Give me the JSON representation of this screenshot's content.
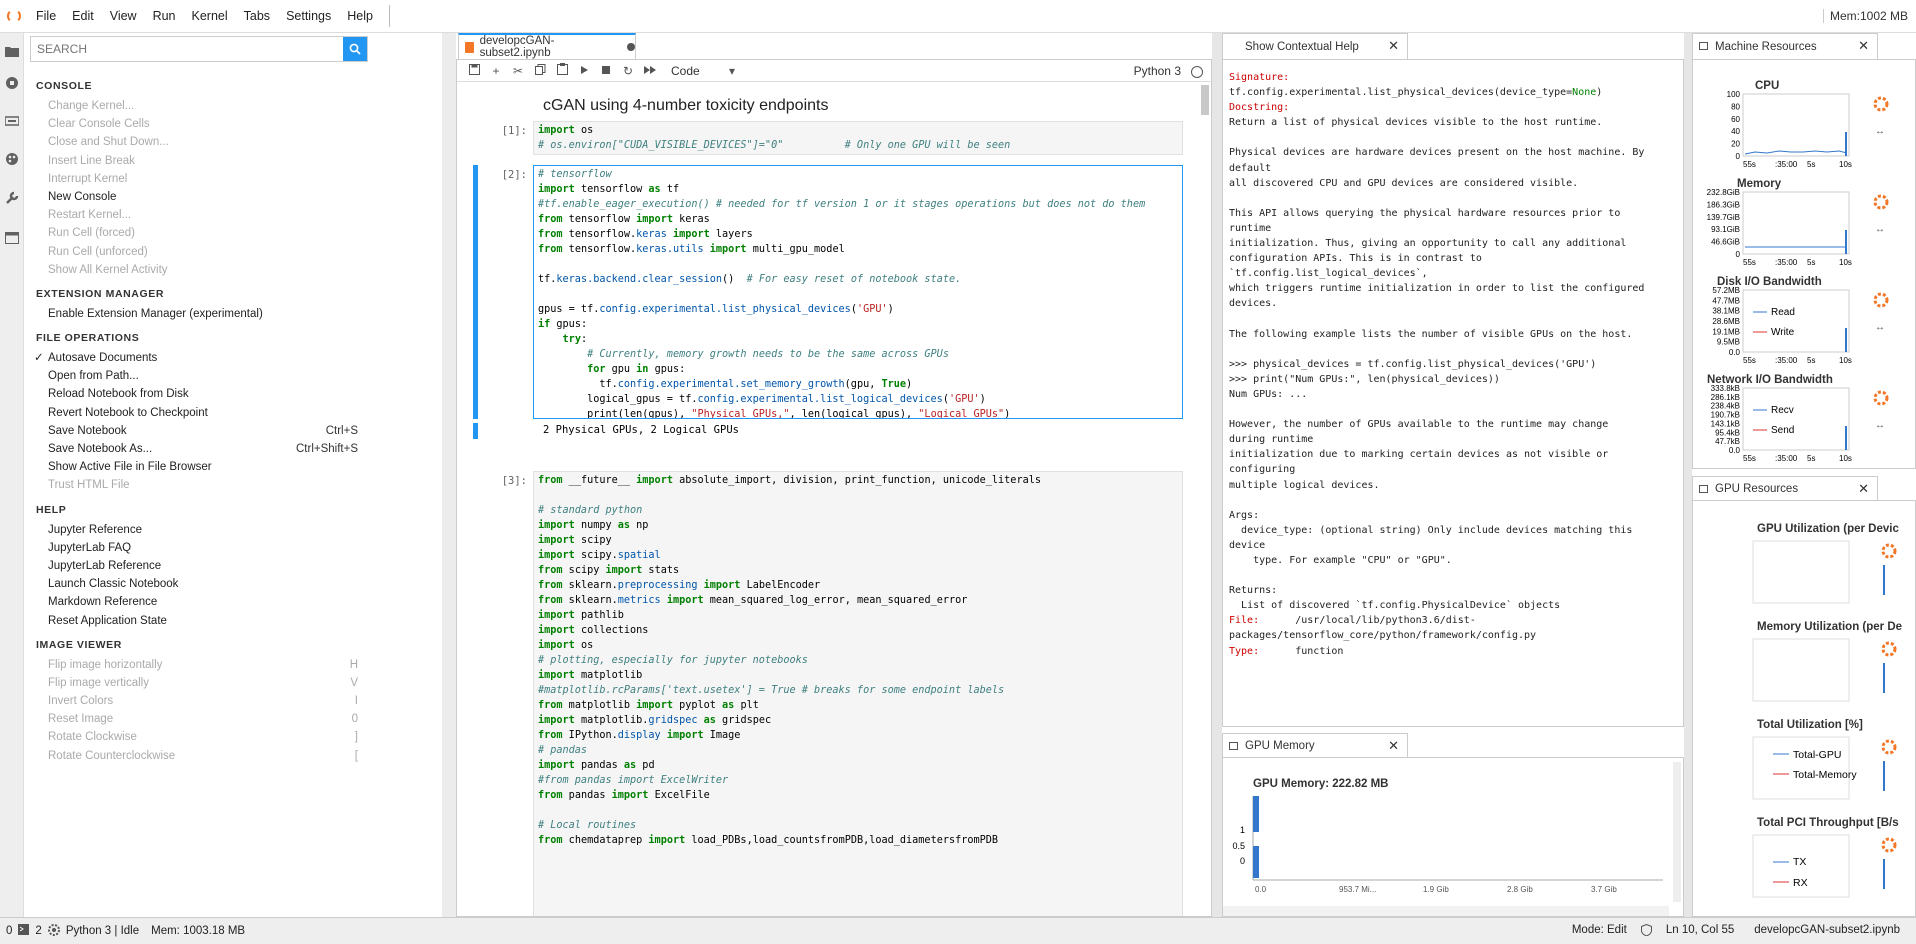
{
  "menubar": {
    "items": [
      "File",
      "Edit",
      "View",
      "Run",
      "Kernel",
      "Tabs",
      "Settings",
      "Help"
    ],
    "memory": "Mem:1002 MB"
  },
  "left_panel": {
    "search_placeholder": "SEARCH",
    "sections": [
      {
        "title": "CONSOLE",
        "items": [
          {
            "label": "Change Kernel...",
            "disabled": true,
            "shortcut": ""
          },
          {
            "label": "Clear Console Cells",
            "disabled": true,
            "shortcut": ""
          },
          {
            "label": "Close and Shut Down...",
            "disabled": true,
            "shortcut": ""
          },
          {
            "label": "Insert Line Break",
            "disabled": true,
            "shortcut": ""
          },
          {
            "label": "Interrupt Kernel",
            "disabled": true,
            "shortcut": ""
          },
          {
            "label": "New Console",
            "disabled": false,
            "shortcut": ""
          },
          {
            "label": "Restart Kernel...",
            "disabled": true,
            "shortcut": ""
          },
          {
            "label": "Run Cell (forced)",
            "disabled": true,
            "shortcut": ""
          },
          {
            "label": "Run Cell (unforced)",
            "disabled": true,
            "shortcut": ""
          },
          {
            "label": "Show All Kernel Activity",
            "disabled": true,
            "shortcut": ""
          }
        ]
      },
      {
        "title": "EXTENSION MANAGER",
        "items": [
          {
            "label": "Enable Extension Manager (experimental)",
            "disabled": false,
            "shortcut": ""
          }
        ]
      },
      {
        "title": "FILE OPERATIONS",
        "items": [
          {
            "label": "Autosave Documents",
            "disabled": false,
            "shortcut": "",
            "checked": true
          },
          {
            "label": "Open from Path...",
            "disabled": false,
            "shortcut": ""
          },
          {
            "label": "Reload Notebook from Disk",
            "disabled": false,
            "shortcut": ""
          },
          {
            "label": "Revert Notebook to Checkpoint",
            "disabled": false,
            "shortcut": ""
          },
          {
            "label": "Save Notebook",
            "disabled": false,
            "shortcut": "Ctrl+S"
          },
          {
            "label": "Save Notebook As...",
            "disabled": false,
            "shortcut": "Ctrl+Shift+S"
          },
          {
            "label": "Show Active File in File Browser",
            "disabled": false,
            "shortcut": ""
          },
          {
            "label": "Trust HTML File",
            "disabled": true,
            "shortcut": ""
          }
        ]
      },
      {
        "title": "HELP",
        "items": [
          {
            "label": "Jupyter Reference",
            "disabled": false,
            "shortcut": ""
          },
          {
            "label": "JupyterLab FAQ",
            "disabled": false,
            "shortcut": ""
          },
          {
            "label": "JupyterLab Reference",
            "disabled": false,
            "shortcut": ""
          },
          {
            "label": "Launch Classic Notebook",
            "disabled": false,
            "shortcut": ""
          },
          {
            "label": "Markdown Reference",
            "disabled": false,
            "shortcut": ""
          },
          {
            "label": "Reset Application State",
            "disabled": false,
            "shortcut": ""
          }
        ]
      },
      {
        "title": "IMAGE VIEWER",
        "items": [
          {
            "label": "Flip image horizontally",
            "disabled": true,
            "shortcut": "H"
          },
          {
            "label": "Flip image vertically",
            "disabled": true,
            "shortcut": "V"
          },
          {
            "label": "Invert Colors",
            "disabled": true,
            "shortcut": "I"
          },
          {
            "label": "Reset Image",
            "disabled": true,
            "shortcut": "0"
          },
          {
            "label": "Rotate Clockwise",
            "disabled": true,
            "shortcut": "]"
          },
          {
            "label": "Rotate Counterclockwise",
            "disabled": true,
            "shortcut": "["
          }
        ]
      }
    ]
  },
  "notebook": {
    "tab_title": "developcGAN-subset2.ipynb",
    "cell_type": "Code",
    "kernel": "Python 3",
    "markdown_title": "cGAN using 4-number toxicity endpoints",
    "prompt1": "[1]:",
    "prompt2": "[2]:",
    "prompt3": "[3]:",
    "output2": "2 Physical GPUs, 2 Logical GPUs"
  },
  "help_panel": {
    "title": "Show Contextual Help",
    "signature_label": "Signature:",
    "signature": "tf.config.experimental.list_physical_devices(device_type=None)",
    "signature_fn": "tf.config.experimental.list_physical_devices(device_type=",
    "signature_default": "None",
    "signature_end": ")",
    "docstring_label": "Docstring:",
    "body": "Return a list of physical devices visible to the host runtime.\n\nPhysical devices are hardware devices present on the host machine. By\ndefault\nall discovered CPU and GPU devices are considered visible.\n\nThis API allows querying the physical hardware resources prior to\nruntime\ninitialization. Thus, giving an opportunity to call any additional\nconfiguration APIs. This is in contrast to\n`tf.config.list_logical_devices`,\nwhich triggers runtime initialization in order to list the configured\ndevices.\n\nThe following example lists the number of visible GPUs on the host.\n\n>>> physical_devices = tf.config.list_physical_devices('GPU')\n>>> print(\"Num GPUs:\", len(physical_devices))\nNum GPUs: ...\n\nHowever, the number of GPUs available to the runtime may change\nduring runtime\ninitialization due to marking certain devices as not visible or\nconfiguring\nmultiple logical devices.\n\nArgs:\n  device_type: (optional string) Only include devices matching this\ndevice\n    type. For example \"CPU\" or \"GPU\".\n\nReturns:\n  List of discovered `tf.config.PhysicalDevice` objects",
    "file_label": "File:",
    "file": "      /usr/local/lib/python3.6/dist-\npackages/tensorflow_core/python/framework/config.py",
    "type_label": "Type:",
    "type": "      function"
  },
  "gpu_memory": {
    "tab": "GPU Memory",
    "title": "GPU Memory: 222.82 MB",
    "yticks": [
      "1",
      "0.5",
      "0"
    ],
    "xticks": [
      "0.0",
      "953.7 Mi...",
      "1.9 Gib",
      "2.8 Gib",
      "3.7 Gib"
    ]
  },
  "machine_resources": {
    "tab": "Machine Resources",
    "cpu": {
      "title": "CPU",
      "yticks": [
        "100",
        "80",
        "60",
        "40",
        "20",
        "0"
      ],
      "xticks": [
        "55s",
        ":35:00",
        "5s",
        "10s"
      ]
    },
    "memory": {
      "title": "Memory",
      "yticks": [
        "232.8GiB",
        "186.3GiB",
        "139.7GiB",
        "93.1GiB",
        "46.6GiB",
        "0"
      ],
      "xticks": [
        "55s",
        ":35:00",
        "5s",
        "10s"
      ]
    },
    "disk": {
      "title": "Disk I/O Bandwidth",
      "yticks": [
        "57.2MB",
        "47.7MB",
        "38.1MB",
        "28.6MB",
        "19.1MB",
        "9.5MB",
        "0.0"
      ],
      "legend": [
        "Read",
        "Write"
      ],
      "xticks": [
        "55s",
        ":35:00",
        "5s",
        "10s"
      ]
    },
    "network": {
      "title": "Network I/O Bandwidth",
      "yticks": [
        "333.8kB",
        "286.1kB",
        "238.4kB",
        "190.7kB",
        "143.1kB",
        "95.4kB",
        "47.7kB",
        "0.0"
      ],
      "legend": [
        "Recv",
        "Send"
      ],
      "xticks": [
        "55s",
        ":35:00",
        "5s",
        "10s"
      ]
    }
  },
  "gpu_resources": {
    "tab": "GPU Resources",
    "titles": [
      "GPU Utilization (per Devic",
      "Memory Utilization (per De",
      "Total Utilization [%]",
      "Total PCI Throughput [B/s"
    ],
    "util_legend": [
      "Total-GPU",
      "Total-Memory"
    ],
    "pci_legend": [
      "TX",
      "RX"
    ]
  },
  "statusbar": {
    "left_num1": "0",
    "left_num2": "2",
    "kernel_status": "Python 3 | Idle",
    "mem": "Mem: 1003.18 MB",
    "mode": "Mode: Edit",
    "position": "Ln 10, Col 55",
    "file": "developcGAN-subset2.ipynb"
  },
  "colors": {
    "accent": "#2196f3",
    "orange": "#f37726",
    "plot_blue": "#3377cc"
  }
}
